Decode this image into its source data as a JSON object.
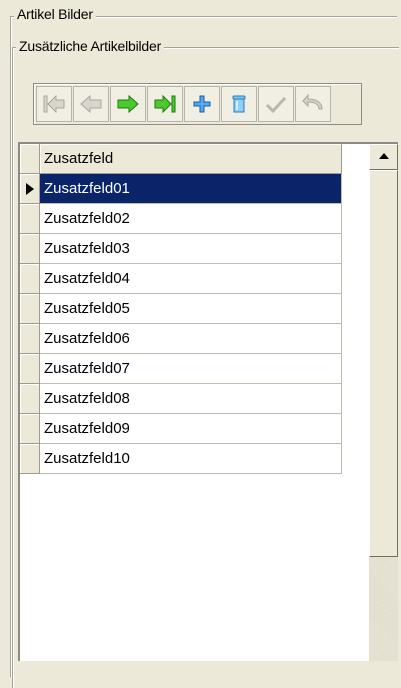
{
  "group": {
    "outer_title": "Artikel Bilder",
    "inner_title": "Zusätzliche Artikelbilder"
  },
  "navigator": {
    "buttons": [
      {
        "name": "first-record",
        "icon": "first-record-icon",
        "enabled": false
      },
      {
        "name": "prior-record",
        "icon": "prior-record-icon",
        "enabled": false
      },
      {
        "name": "next-record",
        "icon": "next-record-icon",
        "enabled": true
      },
      {
        "name": "last-record",
        "icon": "last-record-icon",
        "enabled": true
      },
      {
        "name": "insert-record",
        "icon": "insert-record-icon",
        "enabled": true
      },
      {
        "name": "delete-record",
        "icon": "delete-record-icon",
        "enabled": true
      },
      {
        "name": "post-edit",
        "icon": "post-edit-icon",
        "enabled": false
      },
      {
        "name": "cancel-edit",
        "icon": "cancel-edit-icon",
        "enabled": false
      }
    ]
  },
  "grid": {
    "column_header": "Zusatzfeld",
    "rows": [
      "Zusatzfeld01",
      "Zusatzfeld02",
      "Zusatzfeld03",
      "Zusatzfeld04",
      "Zusatzfeld05",
      "Zusatzfeld06",
      "Zusatzfeld07",
      "Zusatzfeld08",
      "Zusatzfeld09",
      "Zusatzfeld10"
    ],
    "selected_index": 0
  },
  "colors": {
    "window": "#ece9d8",
    "selection": "#0a246a",
    "arrow_enabled": "#3dbb1f",
    "plus": "#3a8fd6",
    "disabled": "#b9b7ad"
  }
}
